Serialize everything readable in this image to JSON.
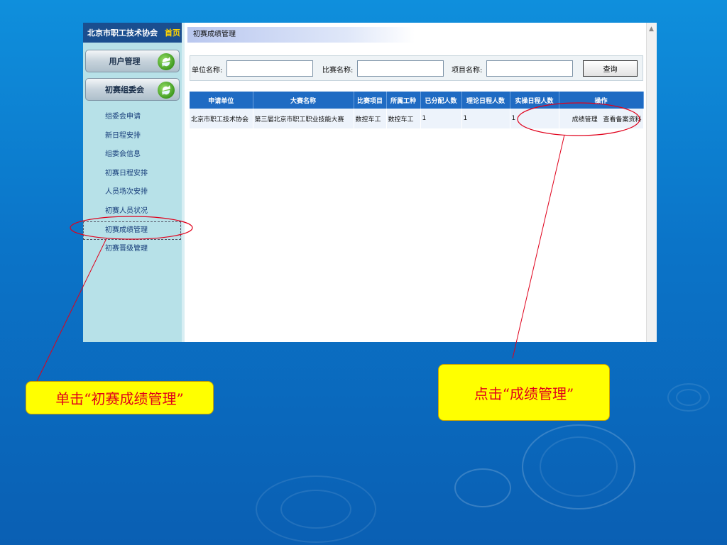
{
  "sidebar": {
    "site_name": "北京市职工技术协会",
    "home_link": "首页",
    "buttons": [
      {
        "label": "用户管理"
      },
      {
        "label": "初赛组委会"
      }
    ],
    "menu": [
      {
        "label": "组委会申请"
      },
      {
        "label": "新日程安排"
      },
      {
        "label": "组委会信息"
      },
      {
        "label": "初赛日程安排"
      },
      {
        "label": "人员场次安排"
      },
      {
        "label": "初赛人员状况"
      },
      {
        "label": "初赛成绩管理",
        "active": true
      },
      {
        "label": "初赛晋级管理"
      }
    ]
  },
  "main": {
    "title": "初赛成绩管理",
    "search": {
      "unit_label": "单位名称:",
      "unit_value": "",
      "contest_label": "比赛名称:",
      "contest_value": "",
      "project_label": "项目名称:",
      "project_value": "",
      "query_button": "查询"
    },
    "table": {
      "headers": [
        "申请单位",
        "大赛名称",
        "比赛项目",
        "所属工种",
        "已分配人数",
        "理论日程人数",
        "实操日程人数",
        "操作"
      ],
      "rows": [
        {
          "unit": "北京市职工技术协会",
          "contest": "第三届北京市职工职业技能大赛",
          "project": "数控车工",
          "trade": "数控车工",
          "assigned": "1",
          "theory": "1",
          "practice": "1",
          "action_score": "成绩管理",
          "action_view": "查看备案资料"
        }
      ]
    }
  },
  "annotations": {
    "left_callout": "单击“初赛成绩管理”",
    "right_callout": "点击“成绩管理”",
    "highlight_color": "#e0001b",
    "callout_bg": "#ffff00"
  }
}
